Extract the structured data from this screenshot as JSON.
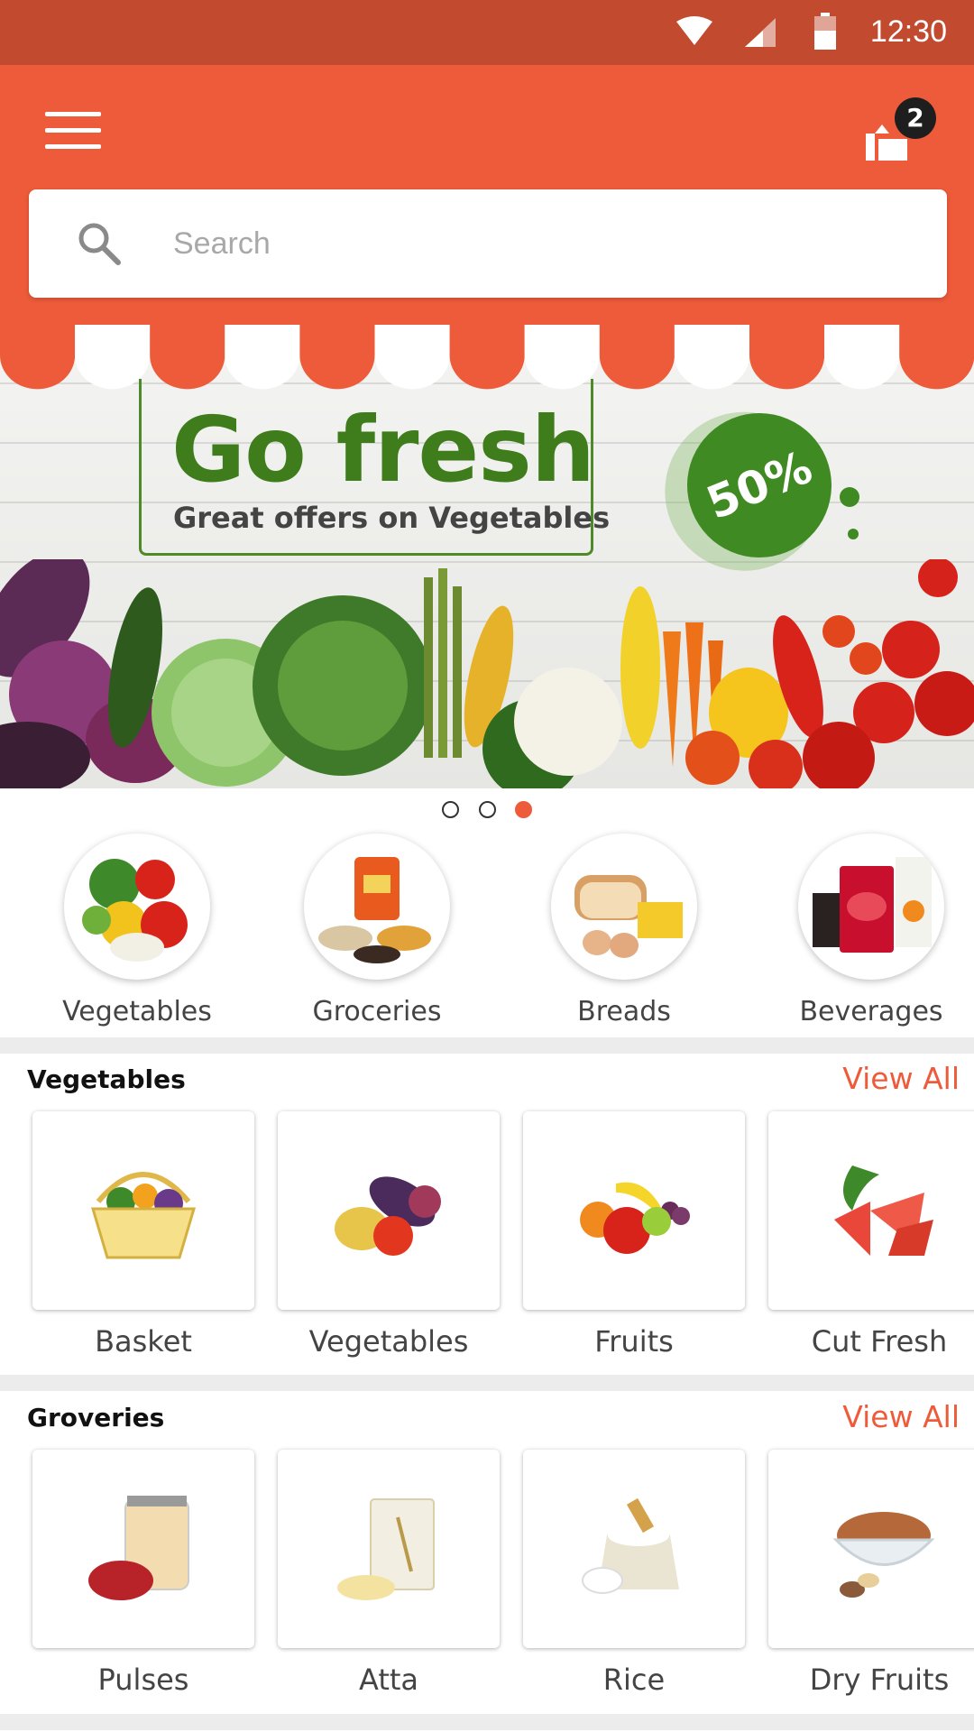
{
  "status_bar": {
    "time": "12:30",
    "icons": [
      "wifi-icon",
      "signal-icon",
      "battery-icon"
    ]
  },
  "header": {
    "menu_icon": "menu-icon",
    "cart_icon": "cart-icon",
    "cart_count": "2"
  },
  "search": {
    "placeholder": "Search",
    "value": ""
  },
  "banner": {
    "title": "Go fresh",
    "subtitle": "Great offers on Vegetables",
    "discount": "50%",
    "slides": 3,
    "active_slide": 3
  },
  "categories": [
    {
      "label": "Vegetables"
    },
    {
      "label": "Groceries"
    },
    {
      "label": "Breads"
    },
    {
      "label": "Beverages"
    }
  ],
  "sections": [
    {
      "title": "Vegetables",
      "view_all": "View All",
      "items": [
        {
          "label": "Basket"
        },
        {
          "label": "Vegetables"
        },
        {
          "label": "Fruits"
        },
        {
          "label": "Cut Fresh"
        }
      ]
    },
    {
      "title": "Groveries",
      "view_all": "View All",
      "items": [
        {
          "label": "Pulses"
        },
        {
          "label": "Atta"
        },
        {
          "label": "Rice"
        },
        {
          "label": "Dry Fruits"
        }
      ]
    }
  ],
  "colors": {
    "primary": "#ee5b3a",
    "status_bar": "#c14a2f",
    "accent_green": "#3f8a22"
  }
}
